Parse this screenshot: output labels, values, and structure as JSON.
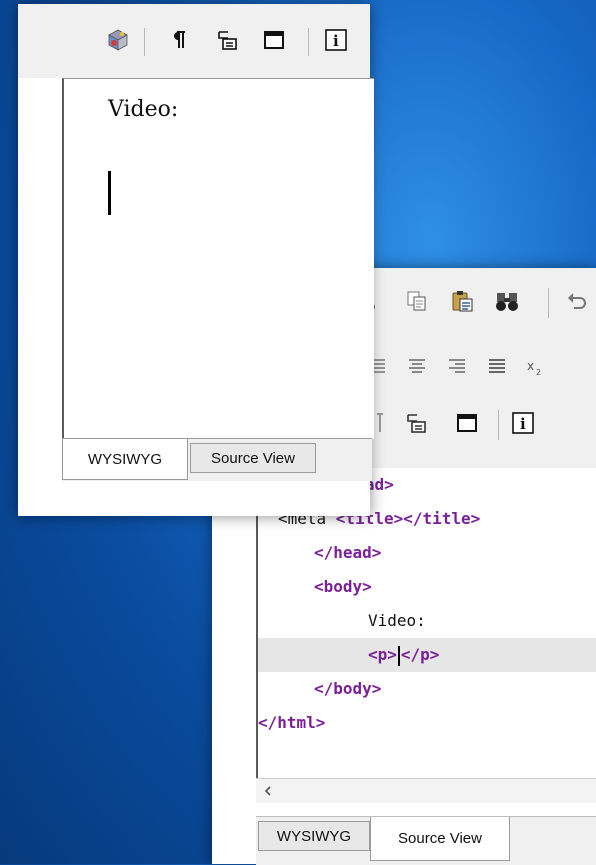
{
  "front_editor": {
    "toolbar": {
      "icons": [
        "3d-cube-icon",
        "paragraph-mark-icon",
        "outdent-icon",
        "window-icon",
        "info-icon"
      ]
    },
    "content": {
      "text": "Video:"
    },
    "tabs": [
      {
        "label": "WYSIWYG",
        "active": true
      },
      {
        "label": "Source View",
        "active": false
      }
    ]
  },
  "back_editor": {
    "toolbar": {
      "row1_icons": [
        "cut-icon",
        "copy-icon",
        "paste-icon",
        "find-binoculars-icon",
        "undo-icon"
      ],
      "row2_icons": [
        "align-left-icon",
        "align-center-icon",
        "align-right-icon",
        "justify-icon",
        "subscript-icon"
      ],
      "row3_icons": [
        "text-icon",
        "outdent-icon",
        "window-icon",
        "info-icon"
      ]
    },
    "source_lines": {
      "l1": "<head>",
      "l2_pre": "<meta ",
      "l2_tag": "<title></title>",
      "l3": "</head>",
      "l4": "<body>",
      "l5": "Video:",
      "l6a": "<p>",
      "l6b": "</p>",
      "l7": "</body>",
      "l8": "</html>"
    },
    "tabs": [
      {
        "label": "WYSIWYG",
        "active": false
      },
      {
        "label": "Source View",
        "active": true
      }
    ]
  },
  "colors": {
    "background": "#0a4c9f",
    "tag_purple": "#7a2199",
    "toolbar_gray": "#f0f0f0",
    "current_line": "#e6e6e6"
  }
}
